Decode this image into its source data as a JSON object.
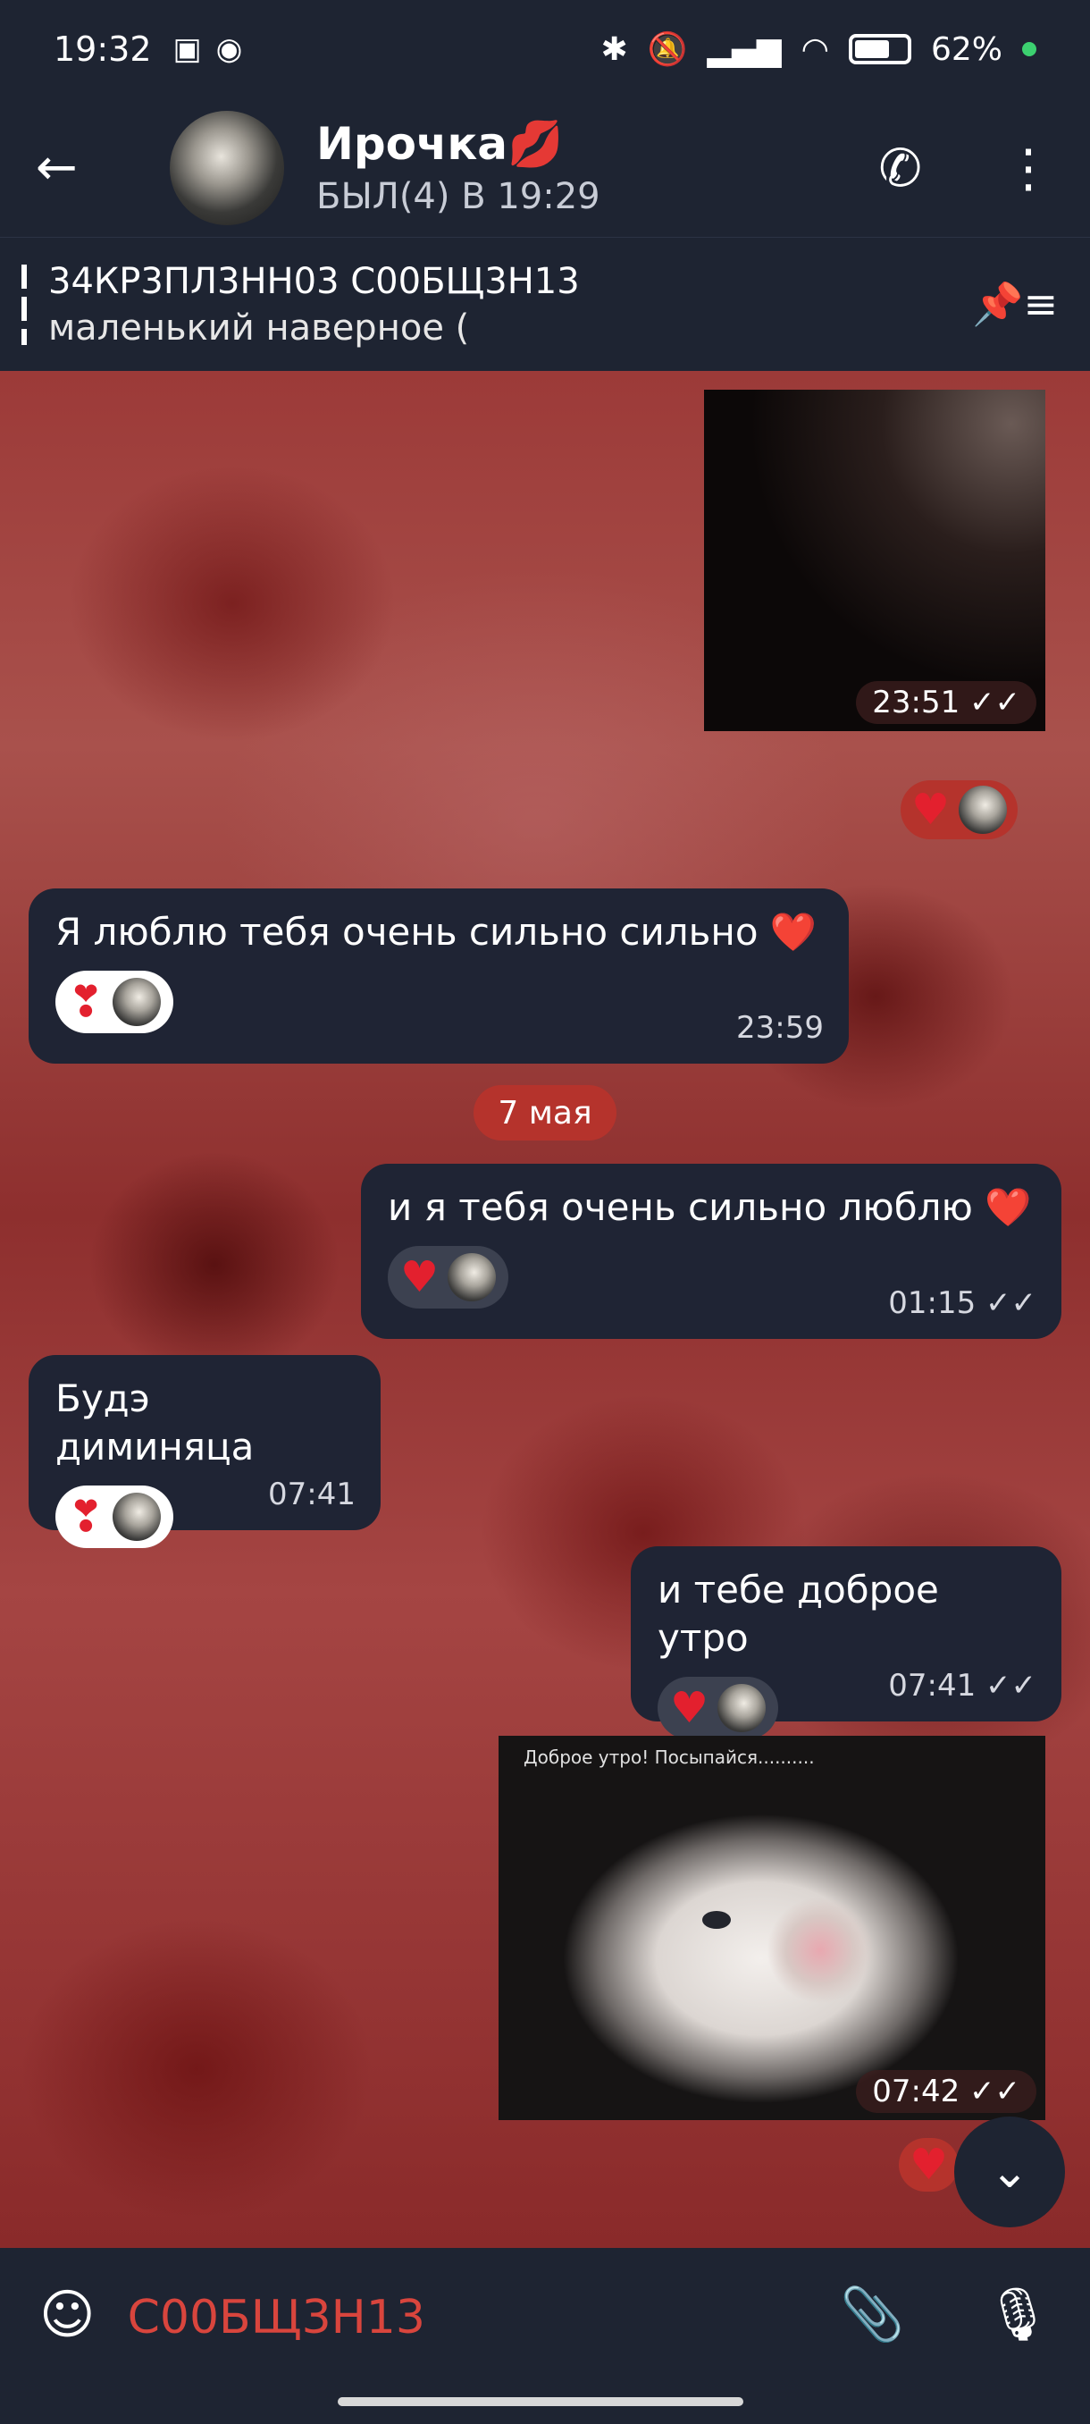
{
  "status_bar": {
    "time": "19:32",
    "battery": "62%"
  },
  "header": {
    "name": "Ирочка",
    "name_emoji": "💋",
    "status": "БЫЛ(4) В 19:29"
  },
  "pinned": {
    "title": "34КР3ПЛ3НН03 С00БЩ3Н13",
    "preview": "маленький наверное ("
  },
  "messages": [
    {
      "time": "23:51"
    },
    {
      "text": "Я люблю тебя очень сильно сильно ❤️",
      "time": "23:59"
    },
    {
      "text": "и я тебя очень сильно люблю ❤️",
      "time": "01:15"
    },
    {
      "text": "Будэ диминяца",
      "time": "07:41"
    },
    {
      "text": "и тебе доброе утро",
      "time": "07:41"
    },
    {
      "caption": "Доброе утро! Посыпайся..........",
      "time": "07:42"
    }
  ],
  "date_separator": "7 мая",
  "composer": {
    "placeholder": "С00БЩ3Н13"
  },
  "colors": {
    "bar": "#1e2432",
    "bubble": "#1f2434",
    "accent": "#d9453d"
  }
}
